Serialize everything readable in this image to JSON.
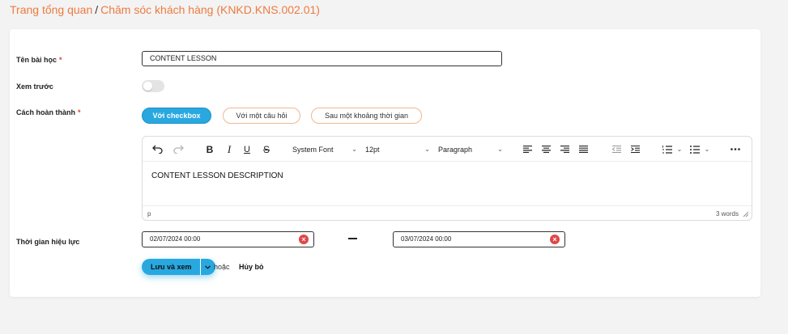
{
  "breadcrumb": {
    "root": "Trang tổng quan",
    "separator": "/",
    "current": "Chăm sóc khách hàng (KNKD.KNS.002.01)"
  },
  "form": {
    "lesson_name": {
      "label": "Tên bài học",
      "required_mark": "*",
      "value": "CONTENT LESSON"
    },
    "preview": {
      "label": "Xem trước",
      "enabled": false
    },
    "completion": {
      "label": "Cách hoàn thành",
      "required_mark": "*",
      "options": [
        "Với checkbox",
        "Với một câu hỏi",
        "Sau một khoảng thời gian"
      ],
      "selected": "Với checkbox"
    },
    "editor": {
      "font_family": "System Font",
      "font_size": "12pt",
      "block_format": "Paragraph",
      "content": "CONTENT LESSON DESCRIPTION",
      "path": "p",
      "word_count": "3 words"
    },
    "validity": {
      "label": "Thời gian hiệu lực",
      "start": "02/07/2024 00:00",
      "end": "03/07/2024 00:00",
      "clear_glyph": "×"
    },
    "actions": {
      "save": "Lưu và xem",
      "or": "hoặc",
      "cancel": "Hủy bỏ"
    }
  },
  "colors": {
    "accent": "#29a8e0",
    "breadcrumb": "#ee7b3d",
    "required": "#e53935",
    "danger": "#e04848"
  },
  "icons": [
    "undo-icon",
    "redo-icon",
    "bold-icon",
    "italic-icon",
    "underline-icon",
    "strikethrough-icon",
    "align-left-icon",
    "align-center-icon",
    "align-right-icon",
    "align-justify-icon",
    "outdent-icon",
    "indent-icon",
    "numbered-list-icon",
    "bullet-list-icon",
    "more-icon",
    "chevron-down-icon",
    "clear-icon",
    "resize-grip-icon"
  ]
}
